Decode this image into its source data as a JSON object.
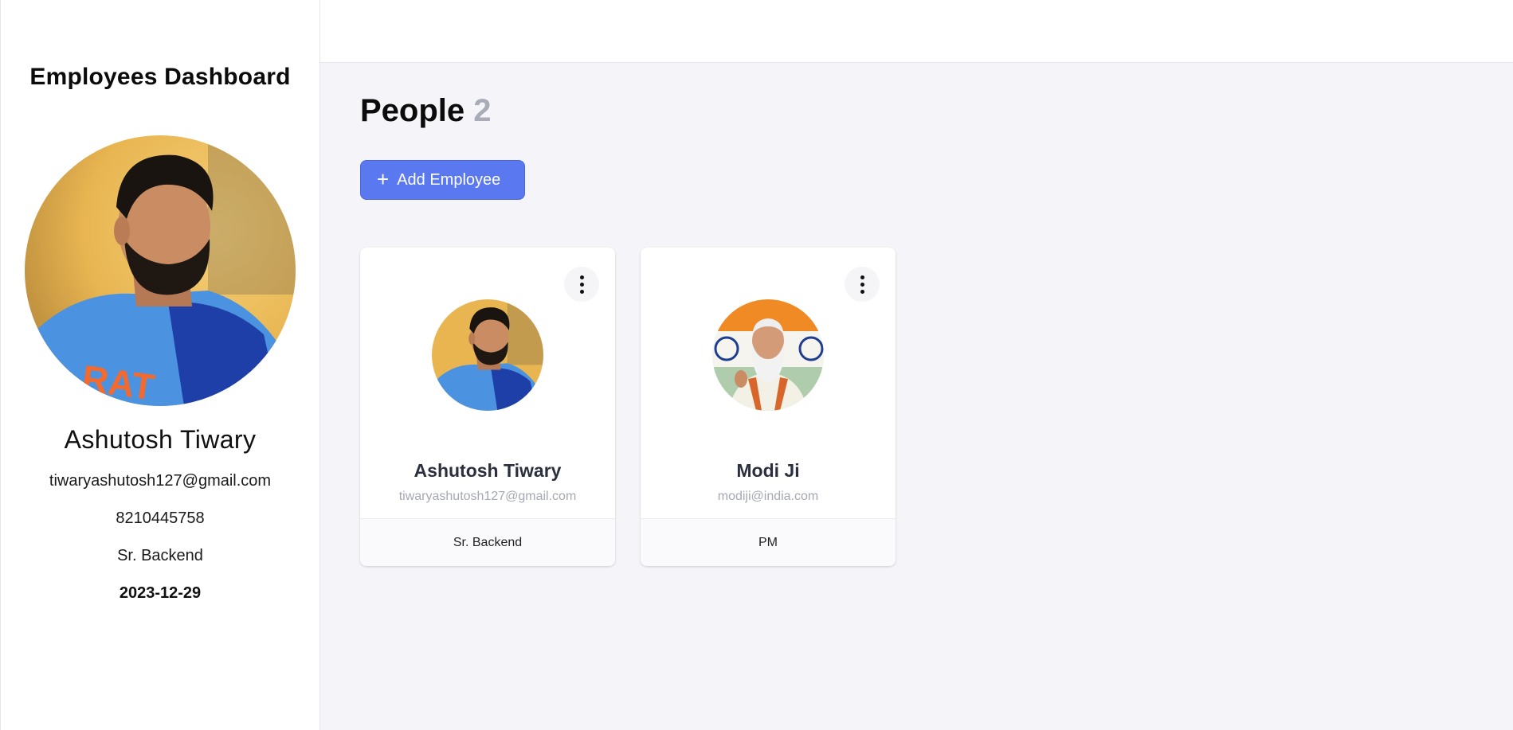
{
  "sidebar": {
    "title": "Employees Dashboard",
    "profile": {
      "name": "Ashutosh Tiwary",
      "email": "tiwaryashutosh127@gmail.com",
      "phone": "8210445758",
      "role": "Sr. Backend",
      "date": "2023-12-29"
    }
  },
  "main": {
    "title": "People",
    "count": "2",
    "add_button_label": "Add Employee",
    "employees": [
      {
        "name": "Ashutosh Tiwary",
        "email": "tiwaryashutosh127@gmail.com",
        "role": "Sr. Backend"
      },
      {
        "name": "Modi Ji",
        "email": "modiji@india.com",
        "role": "PM"
      }
    ]
  },
  "colors": {
    "accent": "#5a78f0",
    "background": "#f5f5f9",
    "muted_text": "#a6a8b3"
  },
  "icons": {
    "add": "plus-icon",
    "card_menu": "more-vertical-icon"
  }
}
